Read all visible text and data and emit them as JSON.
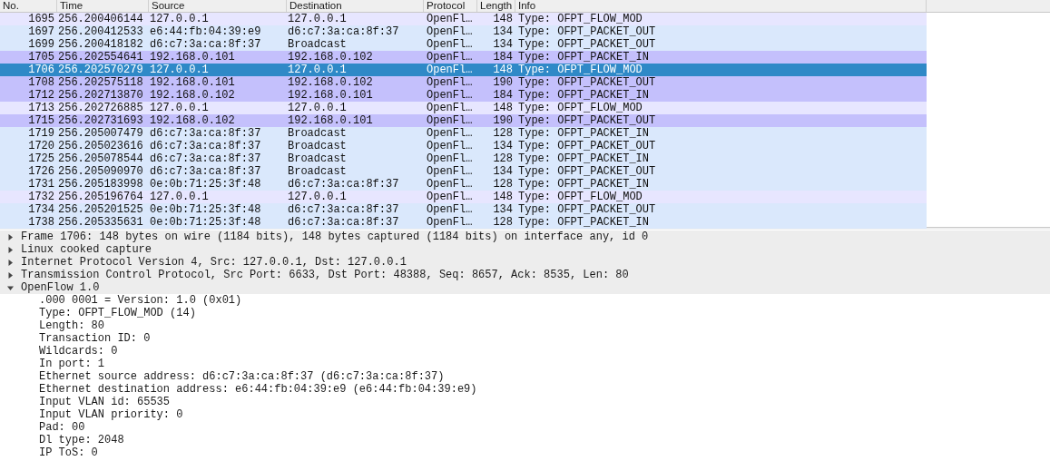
{
  "packet_list": {
    "columns": [
      "No.",
      "Time",
      "Source",
      "Destination",
      "Protocol",
      "Length",
      "Info"
    ],
    "rows": [
      {
        "cells": [
          "1695",
          "256.200406144",
          "127.0.0.1",
          "127.0.0.1",
          "OpenFl…",
          "148",
          "Type: OFPT_FLOW_MOD"
        ],
        "color": "#e7e6ff",
        "selected": false
      },
      {
        "cells": [
          "1697",
          "256.200412533",
          "e6:44:fb:04:39:e9",
          "d6:c7:3a:ca:8f:37",
          "OpenFl…",
          "134",
          "Type: OFPT_PACKET_OUT"
        ],
        "color": "#dae8fc",
        "selected": false
      },
      {
        "cells": [
          "1699",
          "256.200418182",
          "d6:c7:3a:ca:8f:37",
          "Broadcast",
          "OpenFl…",
          "134",
          "Type: OFPT_PACKET_OUT"
        ],
        "color": "#dae8fc",
        "selected": false
      },
      {
        "cells": [
          "1705",
          "256.202554641",
          "192.168.0.101",
          "192.168.0.102",
          "OpenFl…",
          "184",
          "Type: OFPT_PACKET_IN"
        ],
        "color": "#c4c0fc",
        "selected": false
      },
      {
        "cells": [
          "1706",
          "256.202570279",
          "127.0.0.1",
          "127.0.0.1",
          "OpenFl…",
          "148",
          "Type: OFPT_FLOW_MOD"
        ],
        "selected": true
      },
      {
        "cells": [
          "1708",
          "256.202575118",
          "192.168.0.101",
          "192.168.0.102",
          "OpenFl…",
          "190",
          "Type: OFPT_PACKET_OUT"
        ],
        "color": "#c4c0fc",
        "selected": false
      },
      {
        "cells": [
          "1712",
          "256.202713870",
          "192.168.0.102",
          "192.168.0.101",
          "OpenFl…",
          "184",
          "Type: OFPT_PACKET_IN"
        ],
        "color": "#c4c0fc",
        "selected": false
      },
      {
        "cells": [
          "1713",
          "256.202726885",
          "127.0.0.1",
          "127.0.0.1",
          "OpenFl…",
          "148",
          "Type: OFPT_FLOW_MOD"
        ],
        "color": "#e7e6ff",
        "selected": false
      },
      {
        "cells": [
          "1715",
          "256.202731693",
          "192.168.0.102",
          "192.168.0.101",
          "OpenFl…",
          "190",
          "Type: OFPT_PACKET_OUT"
        ],
        "color": "#c4c0fc",
        "selected": false
      },
      {
        "cells": [
          "1719",
          "256.205007479",
          "d6:c7:3a:ca:8f:37",
          "Broadcast",
          "OpenFl…",
          "128",
          "Type: OFPT_PACKET_IN"
        ],
        "color": "#dae8fc",
        "selected": false
      },
      {
        "cells": [
          "1720",
          "256.205023616",
          "d6:c7:3a:ca:8f:37",
          "Broadcast",
          "OpenFl…",
          "134",
          "Type: OFPT_PACKET_OUT"
        ],
        "color": "#dae8fc",
        "selected": false
      },
      {
        "cells": [
          "1725",
          "256.205078544",
          "d6:c7:3a:ca:8f:37",
          "Broadcast",
          "OpenFl…",
          "128",
          "Type: OFPT_PACKET_IN"
        ],
        "color": "#dae8fc",
        "selected": false
      },
      {
        "cells": [
          "1726",
          "256.205090970",
          "d6:c7:3a:ca:8f:37",
          "Broadcast",
          "OpenFl…",
          "134",
          "Type: OFPT_PACKET_OUT"
        ],
        "color": "#dae8fc",
        "selected": false
      },
      {
        "cells": [
          "1731",
          "256.205183998",
          "0e:0b:71:25:3f:48",
          "d6:c7:3a:ca:8f:37",
          "OpenFl…",
          "128",
          "Type: OFPT_PACKET_IN"
        ],
        "color": "#dae8fc",
        "selected": false
      },
      {
        "cells": [
          "1732",
          "256.205196764",
          "127.0.0.1",
          "127.0.0.1",
          "OpenFl…",
          "148",
          "Type: OFPT_FLOW_MOD"
        ],
        "color": "#e7e6ff",
        "selected": false
      },
      {
        "cells": [
          "1734",
          "256.205201525",
          "0e:0b:71:25:3f:48",
          "d6:c7:3a:ca:8f:37",
          "OpenFl…",
          "134",
          "Type: OFPT_PACKET_OUT"
        ],
        "color": "#dae8fc",
        "selected": false
      },
      {
        "cells": [
          "1738",
          "256.205335631",
          "0e:0b:71:25:3f:48",
          "d6:c7:3a:ca:8f:37",
          "OpenFl…",
          "128",
          "Type: OFPT_PACKET_IN"
        ],
        "color": "#dae8fc",
        "selected": false
      }
    ]
  },
  "packet_details": [
    {
      "text": "Frame 1706: 148 bytes on wire (1184 bits), 148 bytes captured (1184 bits) on interface any, id 0",
      "expanded": false
    },
    {
      "text": "Linux cooked capture",
      "expanded": false
    },
    {
      "text": "Internet Protocol Version 4, Src: 127.0.0.1, Dst: 127.0.0.1",
      "expanded": false
    },
    {
      "text": "Transmission Control Protocol, Src Port: 6633, Dst Port: 48388, Seq: 8657, Ack: 8535, Len: 80",
      "expanded": false
    },
    {
      "text": "OpenFlow 1.0",
      "expanded": true,
      "children": [
        {
          "text": ".000 0001 = Version: 1.0 (0x01)"
        },
        {
          "text": "Type: OFPT_FLOW_MOD (14)"
        },
        {
          "text": "Length: 80"
        },
        {
          "text": "Transaction ID: 0"
        },
        {
          "text": "Wildcards: 0"
        },
        {
          "text": "In port: 1"
        },
        {
          "text": "Ethernet source address: d6:c7:3a:ca:8f:37 (d6:c7:3a:ca:8f:37)"
        },
        {
          "text": "Ethernet destination address: e6:44:fb:04:39:e9 (e6:44:fb:04:39:e9)"
        },
        {
          "text": "Input VLAN id: 65535"
        },
        {
          "text": "Input VLAN priority: 0"
        },
        {
          "text": "Pad: 00"
        },
        {
          "text": "Dl type: 2048"
        },
        {
          "text": "IP ToS: 0"
        }
      ]
    }
  ]
}
